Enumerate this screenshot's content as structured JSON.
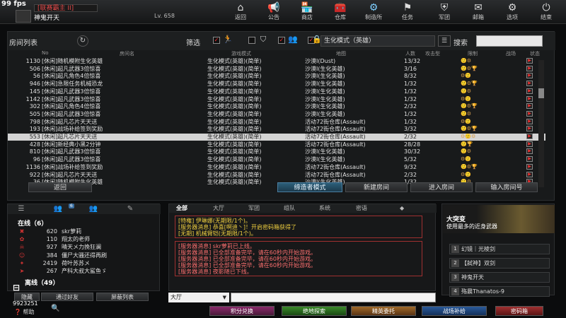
{
  "fps": "99 fps",
  "player": {
    "clan": "[联赛霸主 II]",
    "name": "神鬼开天",
    "level": "Lv. 658"
  },
  "nav": [
    {
      "label": "返回",
      "icon": "return-icon",
      "glyph": "⌂"
    },
    {
      "label": "公告",
      "icon": "announce-icon",
      "glyph": "📢"
    },
    {
      "label": "商店",
      "icon": "shop-icon",
      "glyph": "🏪"
    },
    {
      "label": "仓库",
      "icon": "warehouse-icon",
      "glyph": "🧰"
    },
    {
      "label": "制造所",
      "icon": "factory-icon",
      "glyph": "⚙"
    },
    {
      "label": "任务",
      "icon": "mission-icon",
      "glyph": "⚑"
    },
    {
      "label": "军团",
      "icon": "legion-icon",
      "glyph": "⛨"
    },
    {
      "label": "邮箱",
      "icon": "mail-icon",
      "glyph": "✉"
    },
    {
      "label": "选项",
      "icon": "options-icon",
      "glyph": "⚙"
    },
    {
      "label": "结束",
      "icon": "power-icon",
      "glyph": "⏻"
    }
  ],
  "room": {
    "title": "房间列表",
    "filter_label": "筛选",
    "mode_select": "生化模式（英雄）",
    "search_label": "搜索",
    "columns": [
      "No",
      "房间名",
      "游戏模式",
      "地图",
      "人数",
      "攻击型",
      "限制",
      "战场",
      "状态"
    ],
    "rows": [
      {
        "no": "1130",
        "name": "[休闲]随机模附生化英雄",
        "mode": "生化模式(英雄)(简单)",
        "map": "沙漠Ⅰ(Dust)",
        "count": "13/32",
        "st": ""
      },
      {
        "no": "506",
        "name": "[休闲]超凡武器3倍惊喜",
        "mode": "生化模式(英雄)(简单)",
        "map": "沙漠Ⅰ(生化英雄)",
        "count": "3/16",
        "st": ""
      },
      {
        "no": "56",
        "name": "[休闲]超凡角色4倍惊喜",
        "mode": "生化模式(英雄)(简单)",
        "map": "沙漠Ⅰ(生化英雄)",
        "count": "8/32",
        "st": ""
      },
      {
        "no": "946",
        "name": "[休闲]急限任务机械恐龙",
        "mode": "生化模式(英雄)(简单)",
        "map": "沙漠Ⅰ(生化英雄)",
        "count": "1/32",
        "st": ""
      },
      {
        "no": "145",
        "name": "[休闲]超凡武器3倍惊喜",
        "mode": "生化模式(英雄)(简单)",
        "map": "沙漠Ⅰ(生化英雄)",
        "count": "1/32",
        "st": ""
      },
      {
        "no": "1142",
        "name": "[休闲]超凡武器3倍惊喜",
        "mode": "生化模式(英雄)(简单)",
        "map": "沙漠Ⅰ(生化英雄)",
        "count": "1/32",
        "st": ""
      },
      {
        "no": "302",
        "name": "[休闲]超凡角色4倍惊喜",
        "mode": "生化模式(英雄)(简单)",
        "map": "沙漠Ⅰ(生化英雄)",
        "count": "2/32",
        "st": ""
      },
      {
        "no": "505",
        "name": "[休闲]超凡武器3倍惊喜",
        "mode": "生化模式(英雄)(简单)",
        "map": "沙漠Ⅰ(生化英雄)",
        "count": "1/32",
        "st": ""
      },
      {
        "no": "798",
        "name": "[休闲]超凡芯片天天送",
        "mode": "生化模式(英雄)(简单)",
        "map": "活动72街仓库(Assault)",
        "count": "1/32",
        "st": ""
      },
      {
        "no": "193",
        "name": "[休闲]战场补给签到奖励",
        "mode": "生化模式(英雄)(简单)",
        "map": "活动72街仓库(Assault)",
        "count": "3/32",
        "st": ""
      },
      {
        "no": "553",
        "name": "[休闲]超凡芯片天天送",
        "mode": "生化模式(英雄)(简单)",
        "map": "活动72街仓库(Assault)",
        "count": "2/32",
        "st": "",
        "selected": true
      },
      {
        "no": "428",
        "name": "[休闲]新经典小黑2分钟",
        "mode": "生化模式(英雄)(简单)",
        "map": "活动72街仓库(Assault)",
        "count": "28/28",
        "st": ""
      },
      {
        "no": "810",
        "name": "[休闲]超凡武器3倍惊喜",
        "mode": "生化模式(英雄)(简单)",
        "map": "沙漠Ⅰ(生化英雄)",
        "count": "30/32",
        "st": ""
      },
      {
        "no": "96",
        "name": "[休闲]超凡武器3倍惊喜",
        "mode": "生化模式(英雄)(简单)",
        "map": "沙漠Ⅰ(生化英雄)",
        "count": "5/32",
        "st": ""
      },
      {
        "no": "1136",
        "name": "[休闲]战场补给签到奖励",
        "mode": "生化模式(英雄)(简单)",
        "map": "活动72街仓库(Assault)",
        "count": "9/32",
        "st": ""
      },
      {
        "no": "922",
        "name": "[休闲]超凡芯片天天送",
        "mode": "生化模式(英雄)(简单)",
        "map": "活动72街仓库(Assault)",
        "count": "2/32",
        "st": ""
      },
      {
        "no": "36",
        "name": "[休闲]随机模附生化英雄",
        "mode": "生化模式(英雄)(简单)",
        "map": "沙漠Ⅰ(生化英雄)",
        "count": "1/32",
        "st": ""
      }
    ],
    "buttons": {
      "back": "返回",
      "mode": "缔造者模式",
      "new": "新建房间",
      "enter": "进入房间",
      "enter_no": "输入房间号"
    }
  },
  "friends": {
    "online_label": "在线（6）",
    "offline_label": "离线（49）",
    "list": [
      {
        "num": "620",
        "name": "skr萝莉"
      },
      {
        "num": "110",
        "name": "翔太的老师"
      },
      {
        "num": "927",
        "name": "晴天メ力挽狂澜"
      },
      {
        "num": "384",
        "name": "僵尸大骚还得再刷"
      },
      {
        "num": "2419",
        "name": "荷叶苏苏メ"
      },
      {
        "num": "267",
        "name": "产科大叔大鲨鱼ゞ"
      }
    ],
    "add_button": "通过好友",
    "block_button": "屏蔽列表",
    "badge": "6",
    "id_text": "9923251",
    "help": "帮助",
    "tag": "隐藏"
  },
  "chat": {
    "tabs": [
      "全部",
      "大厅",
      "军团",
      "组队",
      "系统",
      "密语"
    ],
    "box1": [
      "[特権] 伊琳娜(无期限/1个)。",
      "[服务器消息] 恭喜[啊迪丶]！开启密码箱获得了",
      "[无期] 机械臂铠(无期限/1个)。"
    ],
    "box2": [
      "[服务器消息] skr萝莉已上线。",
      "[服务器消息] 已全部准备完毕，请在60秒内开始游戏。",
      "[服务器消息] 已全部准备完毕，请在60秒内开始游戏。",
      "[服务器消息] 已全部准备完毕，请在60秒内开始游戏。",
      "[服务器消息] 夜影随已下线。"
    ],
    "select": "大厅"
  },
  "news": {
    "title": "大突变",
    "subtitle": "使用最多的近身武器",
    "items": [
      {
        "n": "1",
        "label": "幻镜｜光棱剑"
      },
      {
        "n": "2",
        "label": "【弑神】双剑"
      },
      {
        "n": "3",
        "label": "神鬼开天"
      },
      {
        "n": "4",
        "label": "殇晨Thanatos-9"
      }
    ]
  },
  "bottom_tabs": [
    "积分兑换",
    "绝地探索",
    "精英委托",
    "战场补给",
    "密码箱"
  ],
  "colors": {
    "accent": "#7fd0ff",
    "red": "#e04848",
    "gold": "#f0c040"
  }
}
